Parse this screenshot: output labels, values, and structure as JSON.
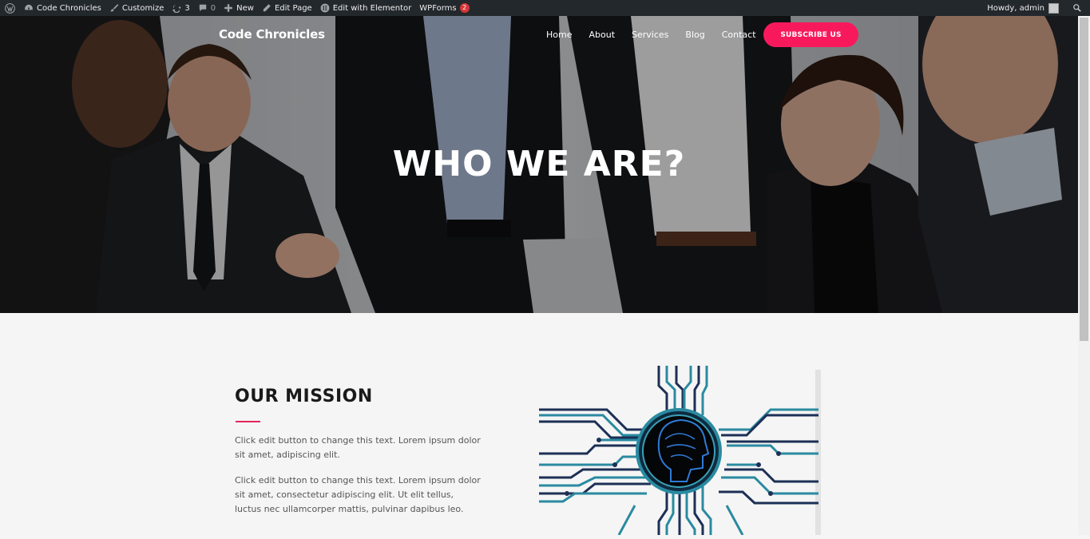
{
  "adminbar": {
    "site_name": "Code Chronicles",
    "customize": "Customize",
    "updates_count": "3",
    "comments_count": "0",
    "new": "New",
    "edit_page": "Edit Page",
    "edit_elementor": "Edit with Elementor",
    "wpforms": "WPForms",
    "wpforms_badge": "2",
    "howdy": "Howdy, admin"
  },
  "header": {
    "site_title": "Code Chronicles",
    "nav": [
      "Home",
      "About",
      "Services",
      "Blog",
      "Contact"
    ],
    "subscribe_label": "SUBSCRIBE US"
  },
  "hero": {
    "heading": "WHO WE ARE?"
  },
  "mission": {
    "title": "OUR MISSION",
    "paragraph1": "Click edit button to change this text. Lorem ipsum dolor sit amet, adipiscing elit.",
    "paragraph2": "Click edit button to change this text. Lorem ipsum dolor sit amet, consectetur adipiscing elit. Ut elit tellus, luctus nec ullamcorper mattis, pulvinar dapibus leo."
  },
  "colors": {
    "accent": "#f8195c",
    "adminbar": "#23282d",
    "divider": "#e3255b"
  }
}
